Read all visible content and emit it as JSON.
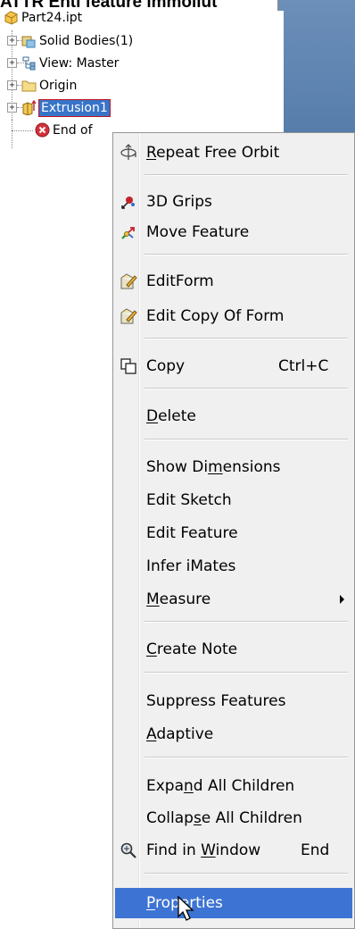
{
  "caption": "ATTR Enti feature immollut",
  "tree": {
    "root_label": "Part24.ipt",
    "items": [
      {
        "label": "Solid Bodies(1)",
        "icon": "solid-bodies-icon"
      },
      {
        "label": "View: Master",
        "icon": "view-icon"
      },
      {
        "label": "Origin",
        "icon": "folder-icon"
      },
      {
        "label": "Extrusion1",
        "icon": "extrusion-icon",
        "selected": true
      },
      {
        "label": "End of",
        "icon": "end-of-part-icon"
      }
    ],
    "expander_symbol": "+"
  },
  "context_menu": {
    "items": [
      {
        "pre": "",
        "ul": "R",
        "post": "epeat Free Orbit",
        "icon": "orbit-icon",
        "shortcut": ""
      },
      {
        "pre": "3D Grips",
        "ul": "",
        "post": "",
        "icon": "3d-grips-icon",
        "shortcut": ""
      },
      {
        "pre": "Move Feature",
        "ul": "",
        "post": "",
        "icon": "move-feature-icon",
        "shortcut": ""
      },
      {
        "pre": "EditForm",
        "ul": "",
        "post": "",
        "icon": "edit-form-icon",
        "shortcut": ""
      },
      {
        "pre": "Edit Copy Of Form",
        "ul": "",
        "post": "",
        "icon": "edit-copy-of-form-icon",
        "shortcut": ""
      },
      {
        "pre": "Copy",
        "ul": "",
        "post": "",
        "icon": "copy-icon",
        "shortcut": "Ctrl+C"
      },
      {
        "pre": "",
        "ul": "D",
        "post": "elete",
        "icon": "",
        "shortcut": ""
      },
      {
        "pre": "Show Di",
        "ul": "m",
        "post": "ensions",
        "icon": "",
        "shortcut": ""
      },
      {
        "pre": "Edit Sketch",
        "ul": "",
        "post": "",
        "icon": "",
        "shortcut": ""
      },
      {
        "pre": "Edit Feature",
        "ul": "",
        "post": "",
        "icon": "",
        "shortcut": ""
      },
      {
        "pre": "Infer iMates",
        "ul": "",
        "post": "",
        "icon": "",
        "shortcut": ""
      },
      {
        "pre": "",
        "ul": "M",
        "post": "easure",
        "icon": "",
        "shortcut": "",
        "submenu": true
      },
      {
        "pre": "",
        "ul": "C",
        "post": "reate Note",
        "icon": "",
        "shortcut": ""
      },
      {
        "pre": "Suppress Features",
        "ul": "",
        "post": "",
        "icon": "",
        "shortcut": ""
      },
      {
        "pre": "",
        "ul": "A",
        "post": "daptive",
        "icon": "",
        "shortcut": ""
      },
      {
        "pre": "Expa",
        "ul": "n",
        "post": "d All Children",
        "icon": "",
        "shortcut": ""
      },
      {
        "pre": "Collap",
        "ul": "s",
        "post": "e All Children",
        "icon": "",
        "shortcut": ""
      },
      {
        "pre": "Find in ",
        "ul": "W",
        "post": "indow",
        "icon": "find-in-window-icon",
        "shortcut": "End"
      },
      {
        "pre": "",
        "ul": "P",
        "post": "roperties",
        "icon": "",
        "shortcut": "",
        "highlighted": true
      }
    ]
  },
  "colors": {
    "selection": "#3874c8",
    "menu_highlight": "#3d74d3",
    "menu_background": "#f0f0f0",
    "viewport": "#5d7fa8"
  }
}
